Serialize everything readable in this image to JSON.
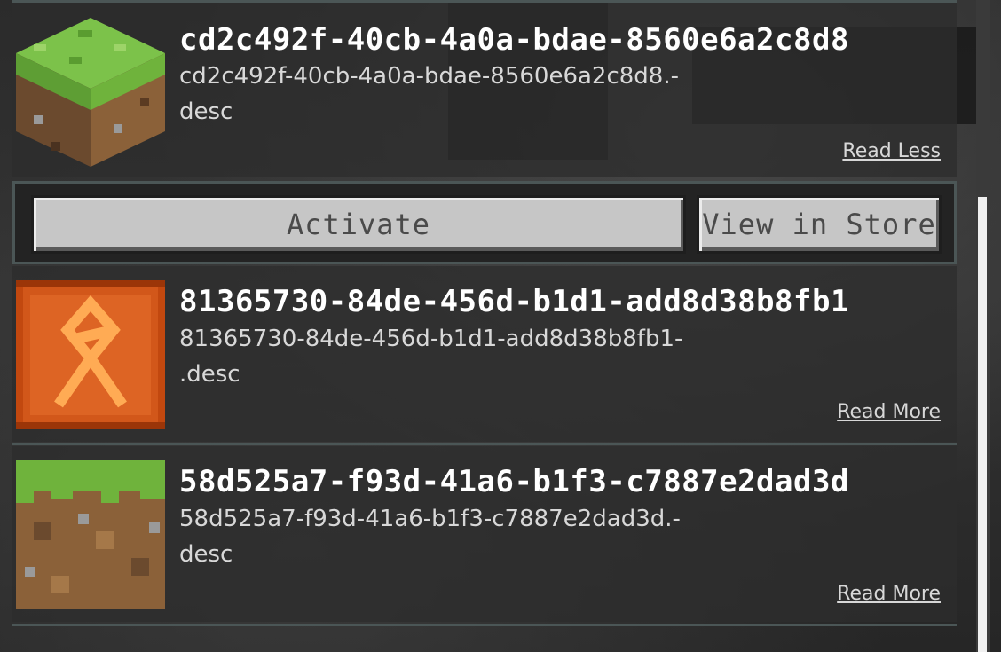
{
  "items": [
    {
      "title": "cd2c492f-40cb-4a0a-bdae-8560e6a2c8d8",
      "desc_line1": "cd2c492f-40cb-4a0a-bdae-8560e6a2c8d8.-",
      "desc_line2": "desc",
      "link": "Read Less",
      "icon": "grass-block-icon"
    },
    {
      "title": "81365730-84de-456d-b1d1-add8d38b8fb1",
      "desc_line1": "81365730-84de-456d-b1d1-add8d38b8fb1-",
      "desc_line2": ".desc",
      "link": "Read More",
      "icon": "rune-icon"
    },
    {
      "title": "58d525a7-f93d-41a6-b1f3-c7887e2dad3d",
      "desc_line1": "58d525a7-f93d-41a6-b1f3-c7887e2dad3d.-",
      "desc_line2": "desc",
      "link": "Read More",
      "icon": "dirt-block-icon"
    }
  ],
  "actions": {
    "activate_label": "Activate",
    "store_label": "View in Store"
  },
  "colors": {
    "separator": "#4b5656",
    "button_face": "#c6c6c6",
    "rune_orange": "#d2571a"
  }
}
